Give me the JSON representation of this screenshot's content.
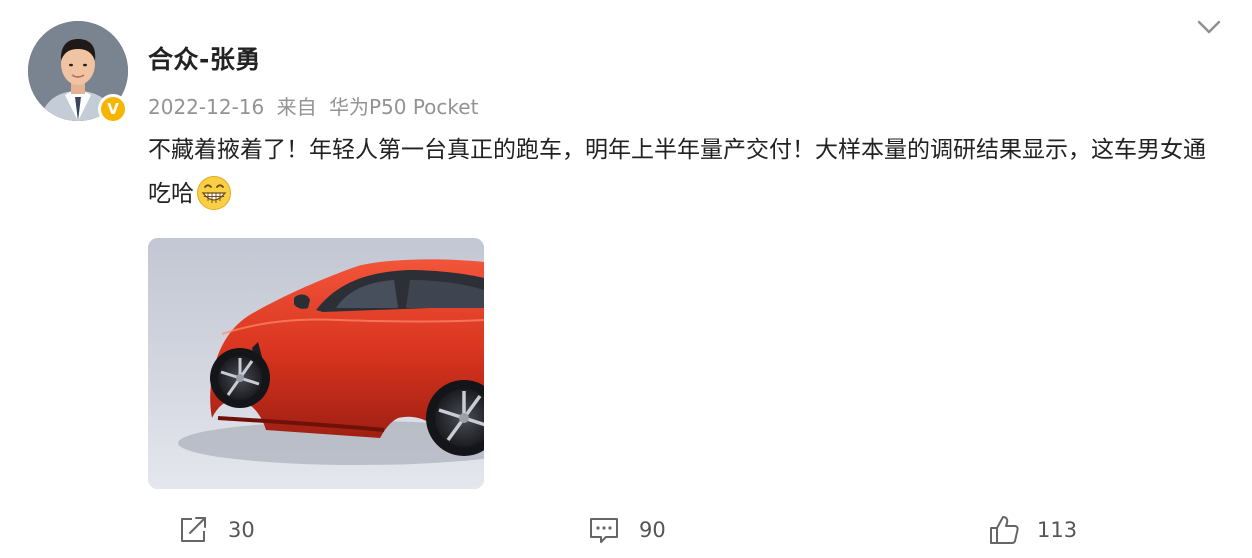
{
  "user": {
    "name": "合众-张勇",
    "verified_badge": "V"
  },
  "meta": {
    "date": "2022-12-16",
    "source_prefix": "来自",
    "device": "华为P50 Pocket"
  },
  "post": {
    "text": "不藏着掖着了！年轻人第一台真正的跑车，明年上半年量产交付！大样本量的调研结果显示，这车男女通吃哈",
    "emoji": "grinning-face-emoji"
  },
  "actions": {
    "share_count": "30",
    "comment_count": "90",
    "like_count": "113"
  },
  "icons": {
    "menu": "chevron-down-icon",
    "share": "share-icon",
    "comment": "comment-icon",
    "like": "thumbs-up-icon"
  },
  "colors": {
    "verified_badge": "#f7b500",
    "car": "#d9341f",
    "meta_text": "#939393"
  }
}
